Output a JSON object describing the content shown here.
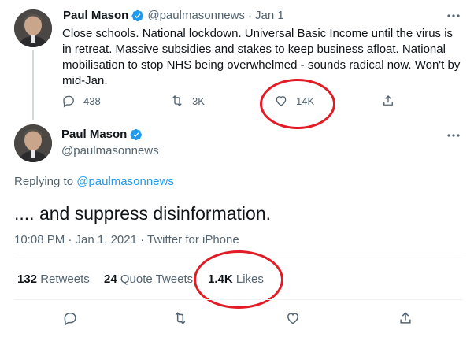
{
  "tweet1": {
    "author_name": "Paul Mason",
    "handle": "@paulmasonnews",
    "separator": "·",
    "date": "Jan 1",
    "text": "Close schools. National lockdown.  Universal Basic Income until the virus is in retreat. Massive subsidies and stakes to keep business afloat. National mobilisation to stop NHS being overwhelmed - sounds radical now. Won't by mid-Jan.",
    "replies": "438",
    "retweets": "3K",
    "likes": "14K"
  },
  "tweet2": {
    "author_name": "Paul Mason",
    "handle": "@paulmasonnews",
    "replying_to_prefix": "Replying to",
    "replying_to_handle": "@paulmasonnews",
    "text": ".... and suppress disinformation.",
    "timestamp": "10:08 PM · Jan 1, 2021 · Twitter for iPhone",
    "retweets_count": "132",
    "retweets_label": "Retweets",
    "quote_count": "24",
    "quote_label": "Quote Tweets",
    "likes_count": "1.4K",
    "likes_label": "Likes"
  },
  "icons": {
    "verified": "verified-badge-icon",
    "reply": "reply-icon",
    "retweet": "retweet-icon",
    "like": "heart-icon",
    "share": "share-icon",
    "more": "more-icon"
  },
  "colors": {
    "accent": "#1d9bf0",
    "muted": "#536471",
    "annotation": "#e21b25"
  }
}
